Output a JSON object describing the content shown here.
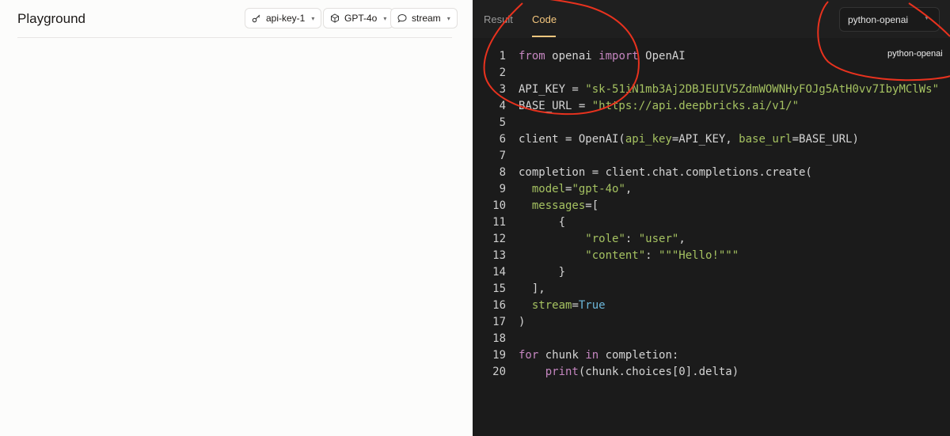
{
  "left": {
    "title": "Playground",
    "pills": [
      {
        "label": "api-key-1",
        "icon": "key-icon"
      },
      {
        "label": "GPT-4o",
        "icon": "cube-icon"
      },
      {
        "label": "stream",
        "icon": "chat-bubble-icon"
      }
    ]
  },
  "right": {
    "tabs": [
      "Result",
      "Code"
    ],
    "active_tab": "Code",
    "language": "python-openai",
    "language_tooltip": "python-openai",
    "code_lines": [
      "1",
      "2",
      "3",
      "4",
      "5",
      "6",
      "7",
      "8",
      "9",
      "10",
      "11",
      "12",
      "13",
      "14",
      "15",
      "16",
      "17",
      "18",
      "19",
      "20"
    ]
  },
  "colors": {
    "accent": "#f5c77e",
    "editor_bg": "#1b1b1b",
    "keyword": "#c586c0",
    "string": "#a5c261",
    "builtin": "#6cb6d9",
    "annotation": "#e8321e"
  }
}
